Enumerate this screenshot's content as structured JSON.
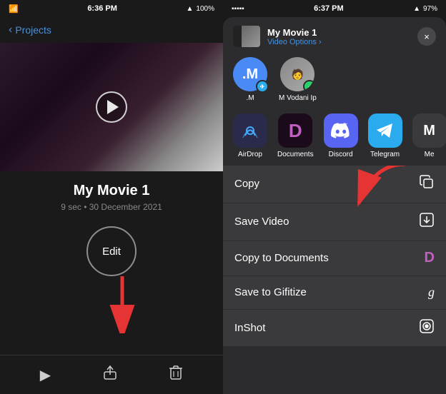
{
  "left": {
    "status": {
      "time": "6:36 PM",
      "battery": "100%"
    },
    "nav": {
      "back_label": "Projects"
    },
    "movie": {
      "title": "My Movie 1",
      "meta": "9 sec • 30 December 2021"
    },
    "edit_btn": "Edit",
    "toolbar": {
      "play_icon": "▶",
      "share_icon": "↑",
      "trash_icon": "🗑"
    }
  },
  "right": {
    "status": {
      "time": "6:37 PM",
      "battery": "97%"
    },
    "share_sheet": {
      "movie_title": "My Movie 1",
      "movie_sub": "Video  Options ›",
      "contacts": [
        {
          "name": ".M",
          "initial": ".M",
          "badge": "telegram"
        },
        {
          "name": "M Vodani Ip",
          "initial": "",
          "badge": "whatsapp"
        }
      ],
      "apps": [
        {
          "name": "AirDrop",
          "icon": "📡"
        },
        {
          "name": "Documents",
          "icon": "D"
        },
        {
          "name": "Discord",
          "icon": "🎮"
        },
        {
          "name": "Telegram",
          "icon": "✈"
        },
        {
          "name": "Me",
          "icon": "M"
        }
      ],
      "actions": [
        {
          "label": "Copy",
          "icon": "⎘"
        },
        {
          "label": "Save Video",
          "icon": "⬇"
        },
        {
          "label": "Copy to Documents",
          "icon": "D"
        },
        {
          "label": "Save to Gifitize",
          "icon": "G"
        },
        {
          "label": "InShot",
          "icon": "◎"
        }
      ]
    }
  }
}
